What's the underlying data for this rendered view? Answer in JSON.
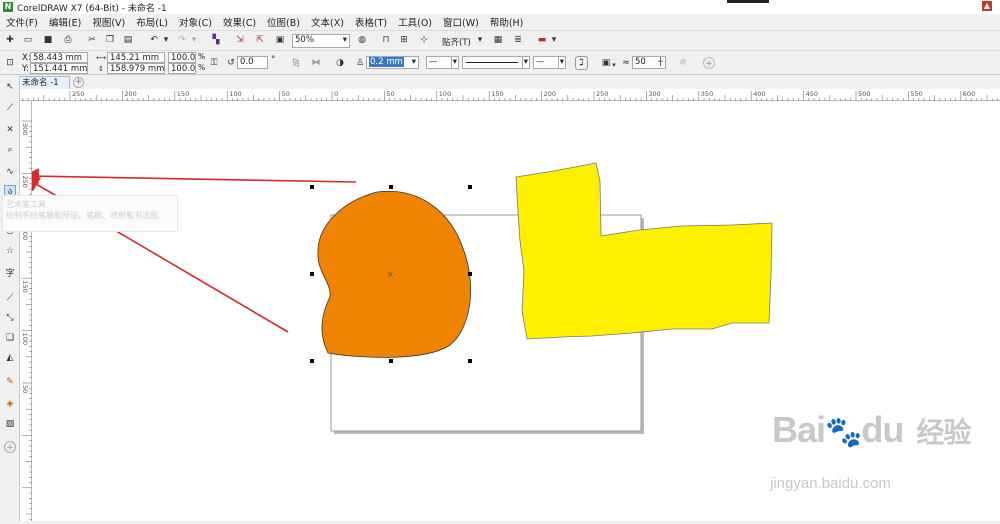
{
  "window": {
    "title": "CorelDRAW X7 (64-Bit) - 未命名 -1",
    "logo_letter": "N"
  },
  "menu": [
    "文件(F)",
    "编辑(E)",
    "视图(V)",
    "布局(L)",
    "对象(C)",
    "效果(C)",
    "位图(B)",
    "文本(X)",
    "表格(T)",
    "工具(O)",
    "窗口(W)",
    "帮助(H)"
  ],
  "toolbar": {
    "zoom": "50%",
    "snap_label": "贴齐(T)"
  },
  "propbar": {
    "x": "58.443 mm",
    "y": "151.441 mm",
    "width": "145.21 mm",
    "height": "158.979 mm",
    "scale_x": "100.0",
    "scale_y": "100.0",
    "pct": "%",
    "rotation": "0.0",
    "degree": "°",
    "outline_width": "0.2 mm",
    "curve_smoothness": "50",
    "x_label": "X:",
    "y_label": "Y:"
  },
  "document_tab": {
    "label": "未命名 -1",
    "add": "+"
  },
  "hruler_ticks": [
    "250",
    "200",
    "150",
    "100",
    "50",
    "0",
    "50",
    "100",
    "150",
    "200",
    "250",
    "300",
    "350",
    "400",
    "450",
    "500",
    "550",
    "600"
  ],
  "vruler_ticks": [
    "300",
    "250",
    "200",
    "150",
    "100",
    "50"
  ],
  "tooltip": {
    "title": "艺术笔工具",
    "body": "绘制手绘笔触和预设、笔刷、喷射和书法图"
  },
  "shapes": {
    "orange": "#f08300",
    "yellow": "#fff000",
    "arrow": "#d42a2a"
  },
  "watermark": {
    "brand": "Bai",
    "brand2": "du",
    "brand_cn": "经验",
    "url": "jingyan.baidu.com"
  }
}
